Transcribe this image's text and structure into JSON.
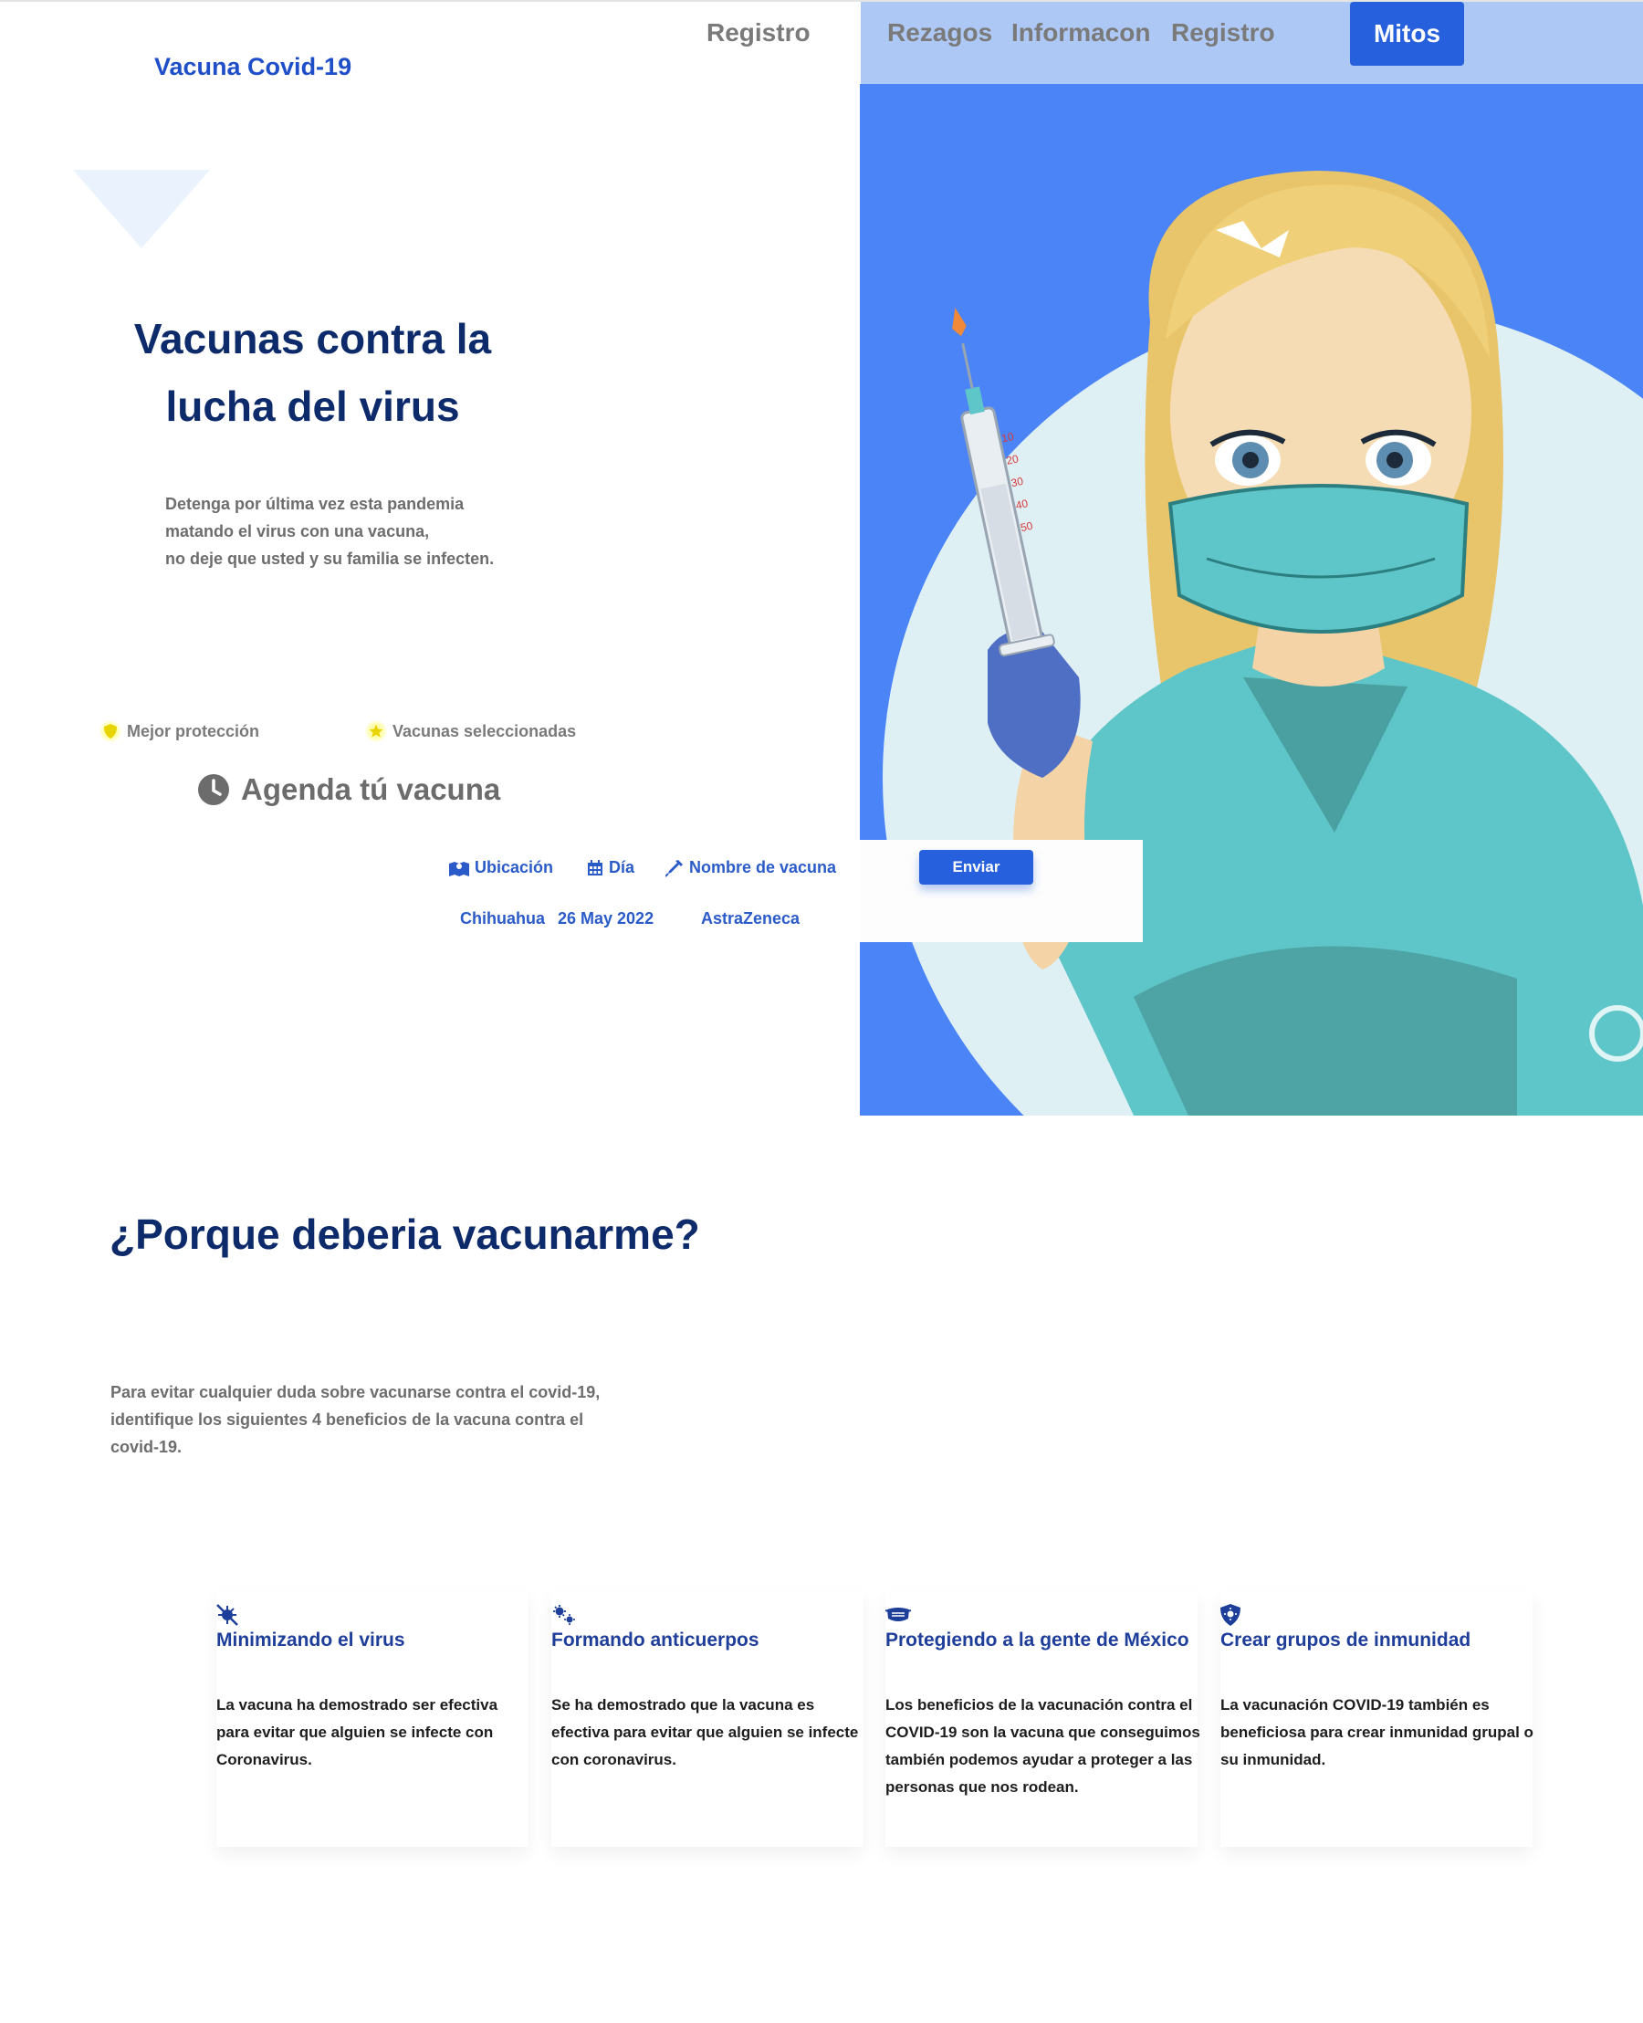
{
  "header": {
    "brand": "Vacuna Covid-19",
    "nav_left": "Registro",
    "nav": [
      "Rezagos",
      "Informacon",
      "Registro"
    ],
    "nav_button": "Mitos"
  },
  "hero": {
    "title_line1": "Vacunas contra la",
    "title_line2": "lucha del virus",
    "desc_line1": "Detenga por última vez esta pandemia",
    "desc_line2": "matando el virus con una vacuna,",
    "desc_line3": "no deje que usted y su familia se infecten.",
    "feature1": "Mejor protección",
    "feature2": "Vacunas seleccionadas",
    "agenda": "Agenda tú vacuna"
  },
  "form": {
    "location_label": "Ubicación",
    "day_label": "Día",
    "vaccine_label": "Nombre de vacuna",
    "location_value": "Chihuahua",
    "day_value": "26 May 2022",
    "vaccine_value": "AstraZeneca",
    "submit": "Enviar"
  },
  "section2": {
    "title": "¿Porque deberia vacunarme?",
    "desc_line1": "Para evitar cualquier duda sobre vacunarse contra el covid-19,",
    "desc_line2": "identifique los siguientes 4 beneficios de la vacuna contra el",
    "desc_line3": "covid-19."
  },
  "cards": [
    {
      "icon": "virus-slash-icon",
      "title": "Minimizando el virus",
      "text": "La vacuna ha demostrado ser efectiva para evitar que alguien se infecte con Coronavirus."
    },
    {
      "icon": "viruses-icon",
      "title": "Formando anticuerpos",
      "text": "Se ha demostrado que la vacuna es efectiva para evitar que alguien se infecte con coronavirus."
    },
    {
      "icon": "head-side-mask-icon",
      "title": "Protegiendo a la gente de México",
      "text": "Los beneficios de la vacunación contra el COVID-19 son la vacuna que conseguimos también podemos ayudar a proteger a las personas que nos rodean."
    },
    {
      "icon": "shield-virus-icon",
      "title": "Crear grupos de inmunidad",
      "text": "La vacunación COVID-19 también es beneficiosa para crear inmunidad grupal o su inmunidad."
    }
  ],
  "illustration": {
    "syringe_marks": [
      "10",
      "20",
      "30",
      "40",
      "50"
    ]
  },
  "colors": {
    "primary": "#2660dd",
    "navy": "#0d2a6b",
    "hero_bg": "#4a84f6",
    "nav_bg": "#aec8f5"
  }
}
